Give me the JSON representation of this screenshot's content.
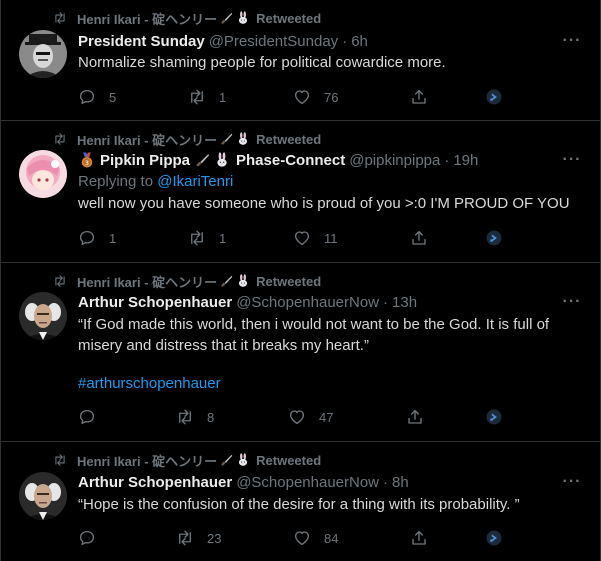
{
  "colors": {
    "background": "#000000",
    "text": "#d9d9d9",
    "muted": "#6e767d",
    "link": "#1d9bf0",
    "divider": "#2f3336"
  },
  "tweets": [
    {
      "retweeter": "Henri Ikari - 碇ヘンリー",
      "retweeted_label": "Retweeted",
      "name": "President Sunday",
      "handle": "@PresidentSunday",
      "time": "6h",
      "text": "Normalize shaming people for political cowardice more.",
      "replies": "5",
      "retweets": "1",
      "likes": "76"
    },
    {
      "retweeter": "Henri Ikari - 碇ヘンリー",
      "retweeted_label": "Retweeted",
      "name": "Pipkin Pippa",
      "name_suffix": "Phase-Connect",
      "handle": "@pipkinpippa",
      "time": "19h",
      "replying_prefix": "Replying to",
      "replying_to": "@IkariTenri",
      "text": "well now you have someone who is proud of you >:0 I'M PROUD OF YOU",
      "replies": "1",
      "retweets": "1",
      "likes": "11"
    },
    {
      "retweeter": "Henri Ikari - 碇ヘンリー",
      "retweeted_label": "Retweeted",
      "name": "Arthur Schopenhauer",
      "handle": "@SchopenhauerNow",
      "time": "13h",
      "text": "“If God made this world, then i would not want to be the God. It is full of misery and distress that it breaks my heart.”",
      "hashtag": "#arthurschopenhauer",
      "replies": "",
      "retweets": "8",
      "likes": "47"
    },
    {
      "retweeter": "Henri Ikari - 碇ヘンリー",
      "retweeted_label": "Retweeted",
      "name": "Arthur Schopenhauer",
      "handle": "@SchopenhauerNow",
      "time": "8h",
      "text": "“Hope is the confusion of the desire for a thing with its probability. ”",
      "replies": "",
      "retweets": "23",
      "likes": "84"
    }
  ],
  "icons": {
    "retweet": "retweet-icon",
    "reply": "reply-icon",
    "like": "heart-icon",
    "share": "share-icon",
    "promote": "promote-icon",
    "more": "more-icon",
    "bunny": "bunny-emoji-icon",
    "knife": "knife-emoji-icon",
    "medal": "medal-emoji-icon"
  },
  "more_glyph": "···"
}
